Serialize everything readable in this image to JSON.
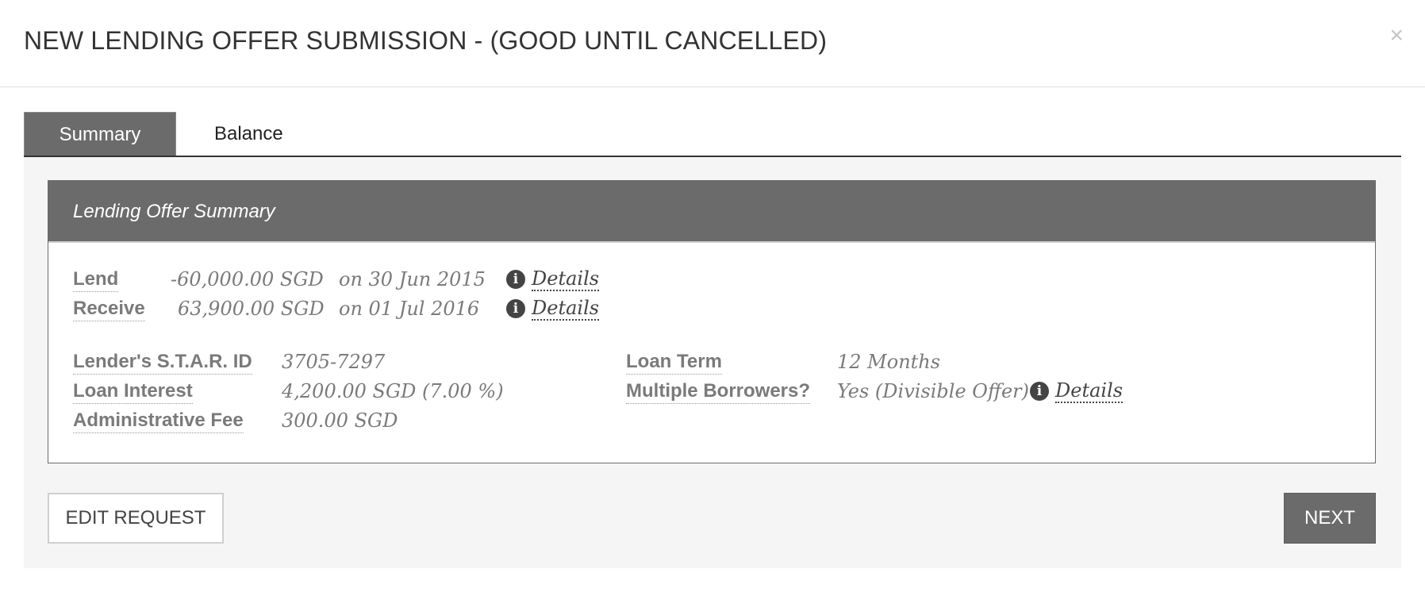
{
  "modal": {
    "title": "NEW LENDING OFFER SUBMISSION - (GOOD UNTIL CANCELLED)",
    "close_label": "×"
  },
  "tabs": [
    {
      "label": "Summary",
      "active": true
    },
    {
      "label": "Balance",
      "active": false
    }
  ],
  "summary": {
    "heading": "Lending Offer Summary",
    "flows": [
      {
        "label": "Lend",
        "amount": "-60,000.00 SGD",
        "date": "on 30 Jun 2015",
        "details": "Details"
      },
      {
        "label": "Receive",
        "amount": "63,900.00 SGD",
        "date": "on 01 Jul 2016",
        "details": "Details"
      }
    ],
    "left_fields": [
      {
        "label": "Lender's S.T.A.R. ID",
        "value": "3705-7297"
      },
      {
        "label": "Loan Interest",
        "value": "4,200.00 SGD (7.00 %)"
      },
      {
        "label": "Administrative Fee",
        "value": "300.00 SGD"
      }
    ],
    "right_fields": [
      {
        "label": "Loan Term",
        "value": "12 Months"
      },
      {
        "label": "Multiple Borrowers?",
        "value": "Yes (Divisible Offer)",
        "details": "Details"
      }
    ]
  },
  "actions": {
    "edit_label": "EDIT REQUEST",
    "next_label": "NEXT"
  },
  "icons": {
    "info": "info-circle-icon",
    "close": "close-icon"
  },
  "colors": {
    "header_gray": "#6b6b6b",
    "panel_bg": "#f5f5f5",
    "text_gray": "#7a7a7a"
  }
}
